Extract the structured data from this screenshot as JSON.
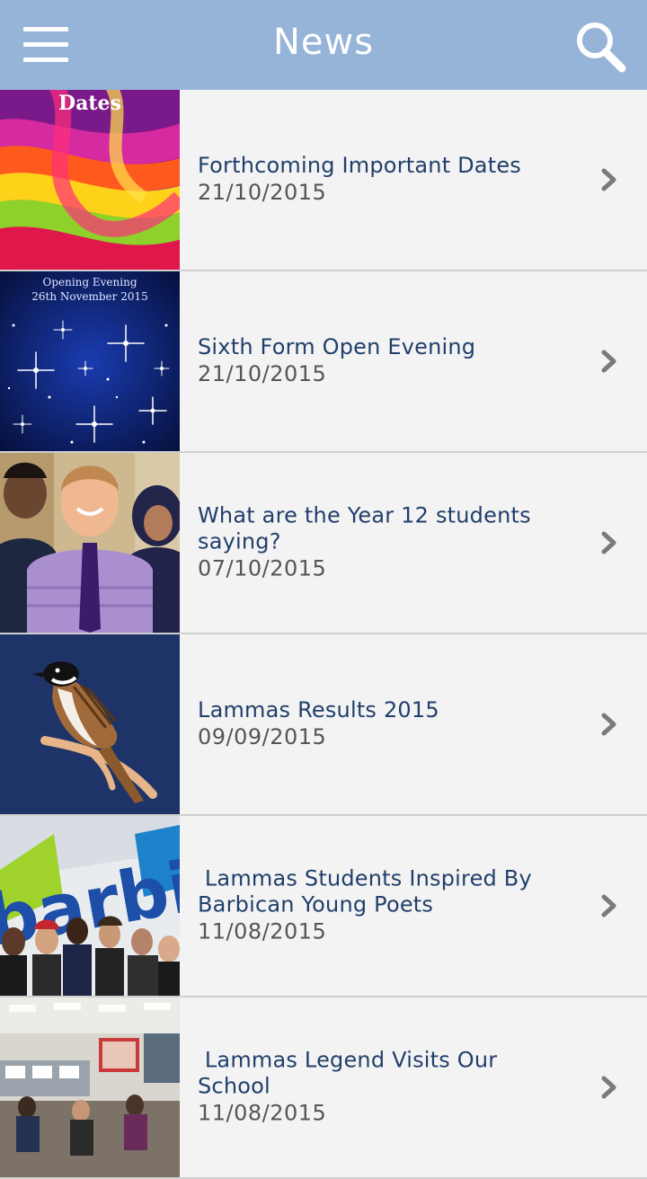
{
  "header": {
    "title": "News",
    "menu_icon": "hamburger-menu-icon",
    "search_icon": "search-icon",
    "background": "#96b3d8"
  },
  "news": {
    "items": [
      {
        "title": "Forthcoming Important Dates",
        "date": "21/10/2015",
        "thumb_text": "Dates"
      },
      {
        "title": "Sixth Form Open Evening",
        "date": "21/10/2015",
        "thumb_text_1": "Opening Evening",
        "thumb_text_2": "26th November 2015"
      },
      {
        "title": "What are the Year 12 students saying?",
        "date": "07/10/2015"
      },
      {
        "title": "Lammas Results 2015",
        "date": "09/09/2015"
      },
      {
        "title": " Lammas Students Inspired By Barbican Young Poets",
        "date": "11/08/2015",
        "thumb_text": "barbic"
      },
      {
        "title": " Lammas Legend Visits Our School",
        "date": "11/08/2015"
      }
    ]
  },
  "colors": {
    "title_text": "#213f6b",
    "date_text": "#555555",
    "row_background": "#f3f3f3",
    "divider": "#cfcfcf",
    "chevron": "#7a7a7a"
  }
}
